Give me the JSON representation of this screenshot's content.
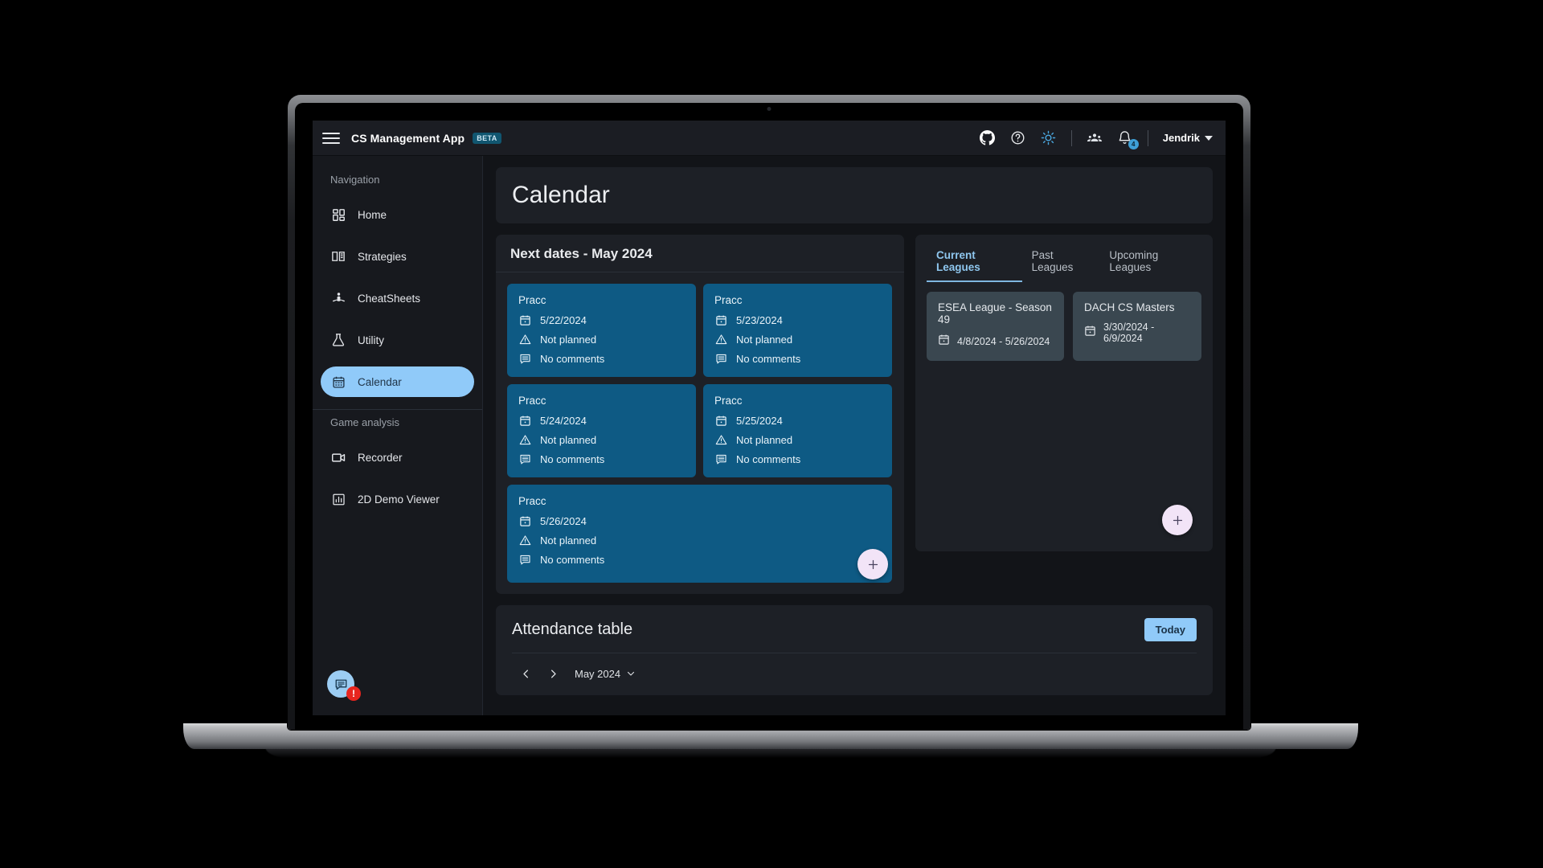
{
  "header": {
    "menu_icon": "hamburger-icon",
    "title": "CS Management App",
    "badge": "BETA",
    "icons": [
      "github-icon",
      "help-circle-icon",
      "sun-icon",
      "team-icon",
      "bell-icon"
    ],
    "notification_count": "4",
    "user_name": "Jendrik"
  },
  "sidebar": {
    "section_navigation": "Navigation",
    "section_game_analysis": "Game analysis",
    "items": [
      {
        "label": "Home",
        "icon": "dashboard-icon",
        "active": false
      },
      {
        "label": "Strategies",
        "icon": "book-icon",
        "active": false
      },
      {
        "label": "CheatSheets",
        "icon": "meditation-icon",
        "active": false
      },
      {
        "label": "Utility",
        "icon": "flask-icon",
        "active": false
      },
      {
        "label": "Calendar",
        "icon": "calendar-icon",
        "active": true
      }
    ],
    "analysis_items": [
      {
        "label": "Recorder",
        "icon": "video-camera-icon"
      },
      {
        "label": "2D Demo Viewer",
        "icon": "bar-chart-icon"
      }
    ],
    "chat_fab": {
      "icon": "chat-bubble-icon",
      "badge": "!"
    }
  },
  "page": {
    "title": "Calendar"
  },
  "next_dates": {
    "title": "Next dates - May 2024",
    "add_label": "+",
    "cards": [
      {
        "name": "Pracc",
        "date": "5/22/2024",
        "status": "Not planned",
        "comments": "No comments"
      },
      {
        "name": "Pracc",
        "date": "5/23/2024",
        "status": "Not planned",
        "comments": "No comments"
      },
      {
        "name": "Pracc",
        "date": "5/24/2024",
        "status": "Not planned",
        "comments": "No comments"
      },
      {
        "name": "Pracc",
        "date": "5/25/2024",
        "status": "Not planned",
        "comments": "No comments"
      },
      {
        "name": "Pracc",
        "date": "5/26/2024",
        "status": "Not planned",
        "comments": "No comments"
      }
    ]
  },
  "leagues": {
    "tabs": [
      {
        "label": "Current Leagues",
        "active": true
      },
      {
        "label": "Past Leagues",
        "active": false
      },
      {
        "label": "Upcoming Leagues",
        "active": false
      }
    ],
    "add_label": "+",
    "cards": [
      {
        "name": "ESEA League - Season 49",
        "dates": "4/8/2024 - 5/26/2024"
      },
      {
        "name": "DACH CS Masters",
        "dates": "3/30/2024 - 6/9/2024"
      }
    ]
  },
  "attendance": {
    "title": "Attendance table",
    "today_label": "Today",
    "month": "May 2024",
    "prev_icon": "chevron-left-icon",
    "next_icon": "chevron-right-icon",
    "dropdown_icon": "chevron-down-icon"
  },
  "colors": {
    "accent": "#90caf9",
    "pracc_card": "#0e5a84",
    "league_card": "#3a4750",
    "panel": "#1d2026",
    "sidebar": "#17191e",
    "header": "#1b1d23",
    "fab": "#f2e4f7",
    "alert": "#e8251f"
  }
}
